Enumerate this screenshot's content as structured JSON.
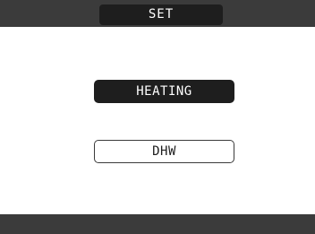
{
  "header": {
    "title": "SET"
  },
  "menu": {
    "items": [
      {
        "label": "HEATING",
        "selected": true
      },
      {
        "label": "DHW",
        "selected": false
      }
    ]
  },
  "colors": {
    "bar": "#3b3b3b",
    "selected_bg": "#1e1e1e",
    "selected_text": "#ffffff",
    "background": "#ffffff"
  }
}
